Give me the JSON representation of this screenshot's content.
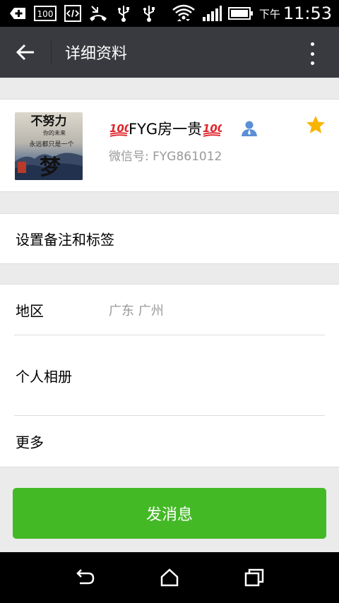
{
  "status_bar": {
    "battery_label": "100",
    "ampm": "下午",
    "time": "11:53"
  },
  "action_bar": {
    "title": "详细资料"
  },
  "profile": {
    "name": "FYG房一贵",
    "wechat_id": "微信号: FYG861012",
    "avatar_text": {
      "line1": "不努力",
      "line2": "你的未来",
      "line3": "永远都只是一个",
      "line4": "梦"
    }
  },
  "rows": {
    "remark_tags": "设置备注和标签",
    "region_label": "地区",
    "region_value": "广东  广州",
    "album_label": "个人相册",
    "more_label": "更多"
  },
  "send_button": "发消息",
  "colors": {
    "action_bar": "#393a3f",
    "send_green": "#44b926",
    "star": "#f7b500",
    "contact_blue": "#5b8fd6"
  }
}
